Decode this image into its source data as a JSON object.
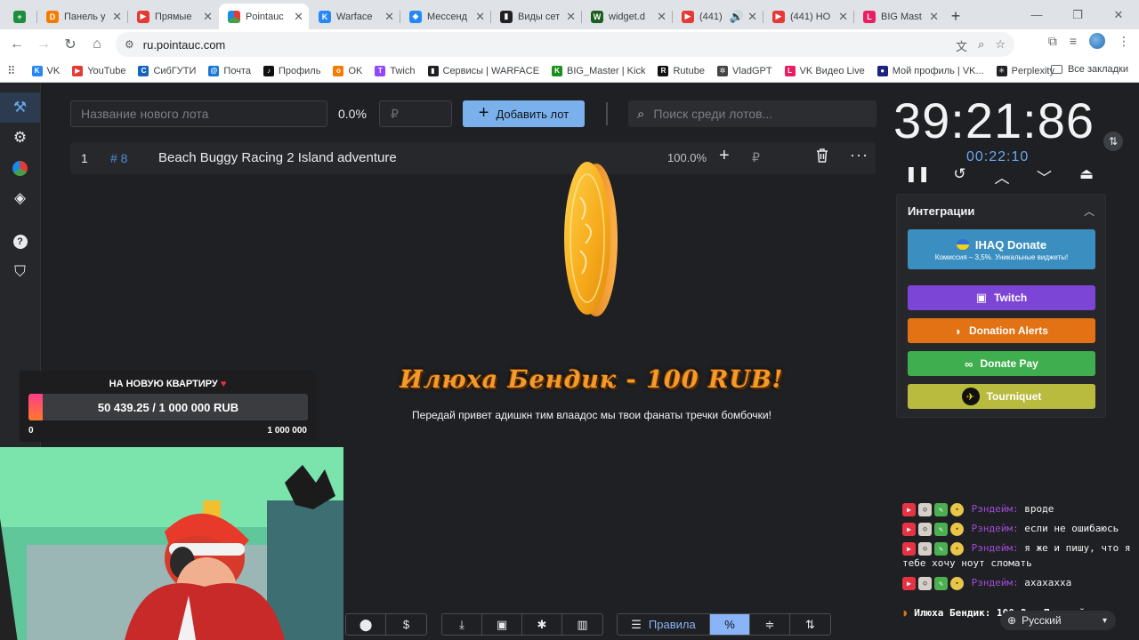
{
  "browser": {
    "tabs": [
      {
        "title": "",
        "favicon": "sheets-icon",
        "color": "#1e8e3e"
      },
      {
        "title": "Панель у",
        "favicon": "donationalerts-icon",
        "color": "#f57c00"
      },
      {
        "title": "Прямые",
        "favicon": "youtube-icon",
        "color": "#e53935"
      },
      {
        "title": "Pointauc",
        "favicon": "pointauc-icon",
        "color": "#4caf50",
        "active": true
      },
      {
        "title": "Warface",
        "favicon": "vk-icon",
        "color": "#2787f5"
      },
      {
        "title": "Мессенд",
        "favicon": "messenger-icon",
        "color": "#2787f5"
      },
      {
        "title": "Виды сет",
        "favicon": "chart-icon",
        "color": "#202124"
      },
      {
        "title": "widget.d",
        "favicon": "widget-icon",
        "color": "#1b5e20"
      },
      {
        "title": "(441)",
        "favicon": "youtube-icon",
        "color": "#e53935",
        "audio": true
      },
      {
        "title": "(441) HO",
        "favicon": "youtube-icon",
        "color": "#e53935"
      },
      {
        "title": "BIG Mast",
        "favicon": "vklive-icon",
        "color": "#e91e63"
      }
    ],
    "address": "ru.pointauc.com",
    "bookmarks": [
      {
        "label": "VK",
        "color": "#2787f5"
      },
      {
        "label": "YouTube",
        "color": "#e53935"
      },
      {
        "label": "СибГУТИ",
        "color": "#1565c0"
      },
      {
        "label": "Почта",
        "color": "#1976d2"
      },
      {
        "label": "Профиль",
        "color": "#111111"
      },
      {
        "label": "OK",
        "color": "#f57c00"
      },
      {
        "label": "Twich",
        "color": "#9146ff"
      },
      {
        "label": "Сервисы | WARFACE",
        "color": "#202124"
      },
      {
        "label": "BIG_Master | Kick",
        "color": "#1b8f1b"
      },
      {
        "label": "Rutube",
        "color": "#111111"
      },
      {
        "label": "VladGPT",
        "color": "#444444"
      },
      {
        "label": "VK Видео Live",
        "color": "#e91e63"
      },
      {
        "label": "Мой профиль | VK...",
        "color": "#1a237e"
      },
      {
        "label": "Perplexity",
        "color": "#202124"
      }
    ],
    "all_bookmarks": "Все закладки"
  },
  "auction": {
    "lot_name_placeholder": "Название нового лота",
    "percent": "0.0%",
    "rub_placeholder": "₽",
    "add_lot": "Добавить лот",
    "search_placeholder": "Поиск среди лотов...",
    "lots": [
      {
        "index": "1",
        "id": "# 8",
        "title": "Beach Buggy Racing 2 Island adventure",
        "percent": "100.0%",
        "currency": "₽"
      }
    ]
  },
  "donation": {
    "title": "Илюха Бендик - 100 RUB!",
    "message": "Передай привет адишкн тим влаадос мы твои фанаты тречки бомбочки!"
  },
  "timer": {
    "main": "39:21:86",
    "sub": "00:22:10"
  },
  "integrations": {
    "title": "Интеграции",
    "ihaq": {
      "label": "IHAQ Donate",
      "sub": "Комиссия – 3,5%. Уникальные виджеты!"
    },
    "twitch": "Twitch",
    "donation_alerts": "Donation Alerts",
    "donate_pay": "Donate Pay",
    "tourniquet": "Tourniquet"
  },
  "goal": {
    "title": "НА НОВУЮ КВАРТИРУ",
    "progress_text": "50 439.25 / 1 000 000 RUB",
    "progress_fraction": 0.0504,
    "min": "0",
    "max": "1 000 000"
  },
  "bottom_bar": {
    "rules": "Правила",
    "percent": "%"
  },
  "chat": {
    "messages": [
      {
        "name": "Рэндейм:",
        "text": "вроде"
      },
      {
        "name": "Рэндейм:",
        "text": "если не ошибаюсь"
      },
      {
        "name": "Рэндейм:",
        "text": "я же и пишу, что я тебе хочу ноут сломать"
      },
      {
        "name": "Рэндейм:",
        "text": "ахахахха"
      }
    ],
    "donation_line": "Илюха Бендик: 100 ₽ • Передай"
  },
  "language": "Русский"
}
